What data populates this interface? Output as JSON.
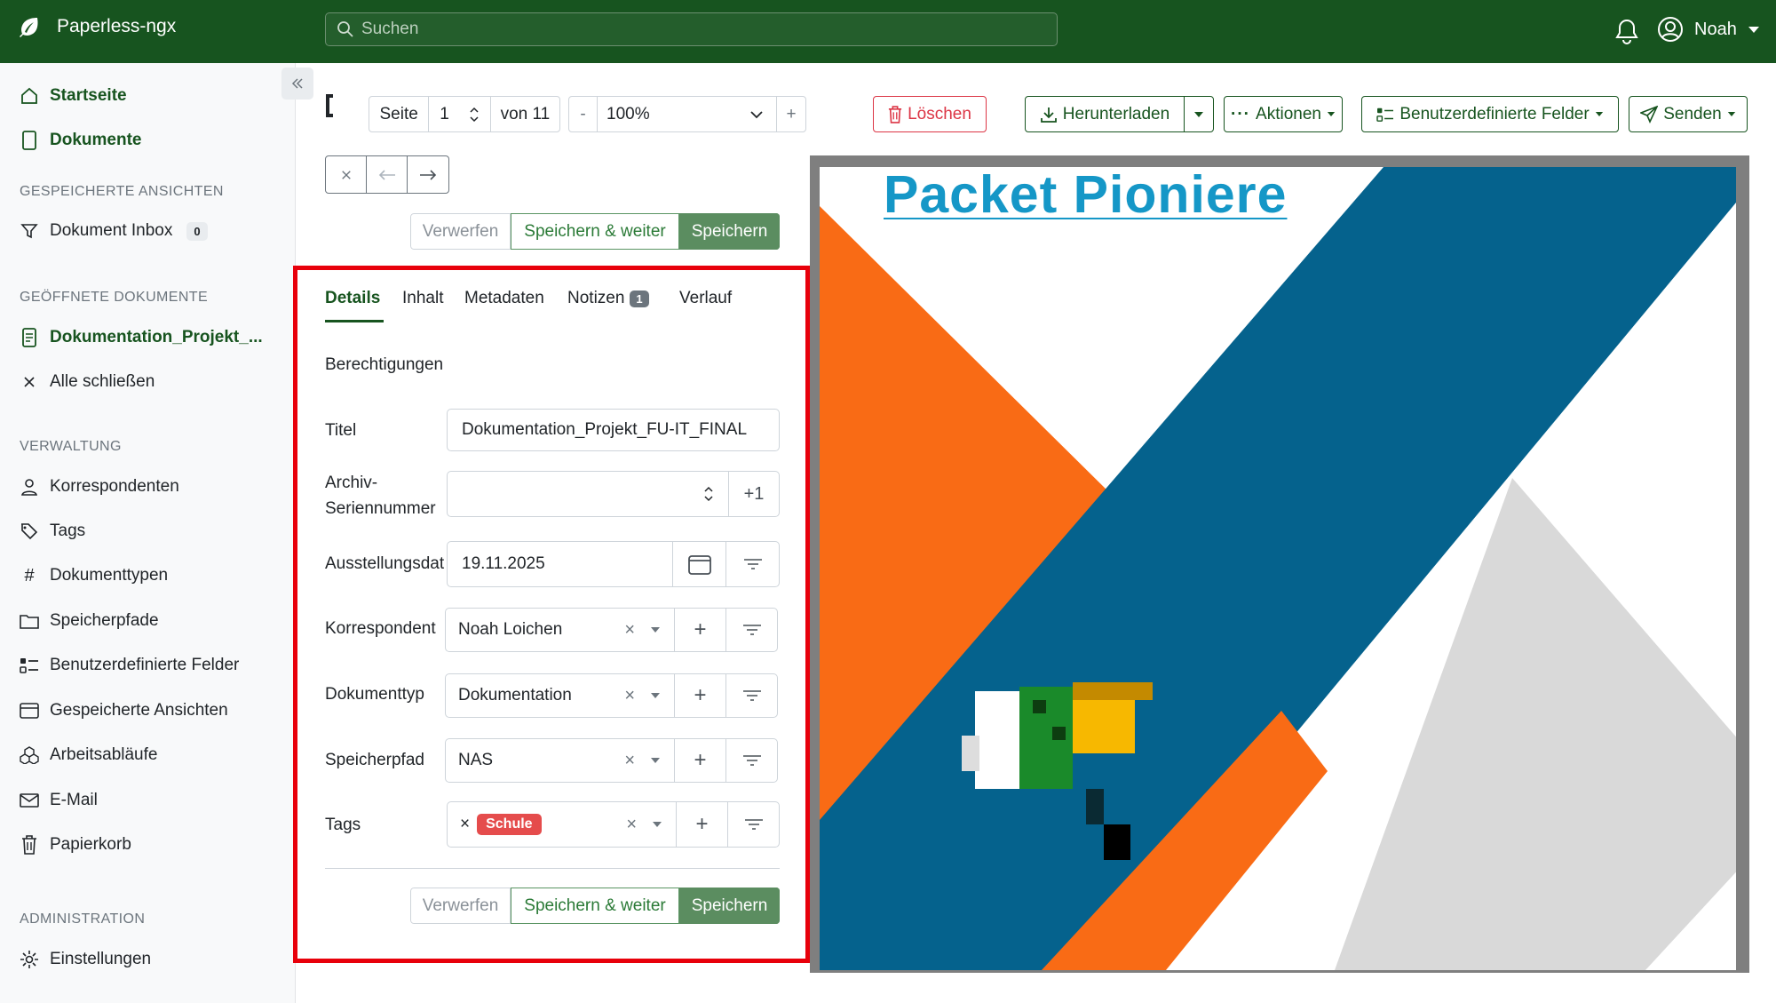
{
  "app": {
    "title": "Paperless-ngx",
    "user": "Noah"
  },
  "search": {
    "placeholder": "Suchen"
  },
  "sidebar": {
    "main": [
      {
        "label": "Startseite",
        "icon": "house-icon"
      },
      {
        "label": "Dokumente",
        "icon": "file-icon"
      }
    ],
    "saved_views_header": "GESPEICHERTE ANSICHTEN",
    "saved_views": [
      {
        "label": "Dokument Inbox",
        "count": "0",
        "icon": "funnel-icon"
      }
    ],
    "open_docs_header": "GEÖFFNETE DOKUMENTE",
    "open_docs": [
      {
        "label": "Dokumentation_Projekt_...",
        "icon": "file-text-icon"
      }
    ],
    "close_all": "Alle schließen",
    "manage_header": "VERWALTUNG",
    "manage": [
      {
        "label": "Korrespondenten",
        "icon": "person-icon"
      },
      {
        "label": "Tags",
        "icon": "tags-icon"
      },
      {
        "label": "Dokumenttypen",
        "icon": "hash-icon"
      },
      {
        "label": "Speicherpfade",
        "icon": "folder-icon"
      },
      {
        "label": "Benutzerdefinierte Felder",
        "icon": "ui-checks-icon"
      },
      {
        "label": "Gespeicherte Ansichten",
        "icon": "window-icon"
      },
      {
        "label": "Arbeitsabläufe",
        "icon": "boxes-icon"
      },
      {
        "label": "E-Mail",
        "icon": "envelope-icon"
      },
      {
        "label": "Papierkorb",
        "icon": "trash-icon"
      }
    ],
    "admin_header": "ADMINISTRATION",
    "admin": [
      {
        "label": "Einstellungen",
        "icon": "gear-icon"
      }
    ]
  },
  "toolbar": {
    "page_label": "Seite",
    "page_value": "1",
    "page_of": "von 11",
    "zoom_minus": "-",
    "zoom_value": "100%",
    "zoom_plus": "+",
    "delete": "Löschen",
    "download": "Herunterladen",
    "actions": "Aktionen",
    "custom_fields": "Benutzerdefinierte Felder",
    "send": "Senden"
  },
  "save_bar": {
    "discard": "Verwerfen",
    "save_next": "Speichern & weiter",
    "save": "Speichern"
  },
  "tabs": [
    {
      "label": "Details",
      "active": true
    },
    {
      "label": "Inhalt"
    },
    {
      "label": "Metadaten"
    },
    {
      "label": "Notizen",
      "badge": "1"
    },
    {
      "label": "Verlauf"
    }
  ],
  "form": {
    "permissions": "Berechtigungen",
    "title_label": "Titel",
    "title_value": "Dokumentation_Projekt_FU-IT_FINAL",
    "asn_label_1": "Archiv-",
    "asn_label_2": "Seriennummer",
    "asn_value": "",
    "asn_plus": "+1",
    "date_label": "Ausstellungsdat",
    "date_value": "19.11.2025",
    "correspondent_label": "Korrespondent",
    "correspondent_value": "Noah Loichen",
    "doctype_label": "Dokumenttyp",
    "doctype_value": "Dokumentation",
    "storage_label": "Speicherpfad",
    "storage_value": "NAS",
    "tags_label": "Tags",
    "tags_value": "Schule"
  },
  "preview": {
    "doc_title": "Packet Pioniere"
  },
  "colors": {
    "brand": "#17541f",
    "danger": "#dc3545",
    "tag": "#e54c4c",
    "doc_title": "#1597c7",
    "doc_blue": "#05628d",
    "doc_orange": "#f96b15",
    "doc_gray": "#d9d9d9"
  }
}
